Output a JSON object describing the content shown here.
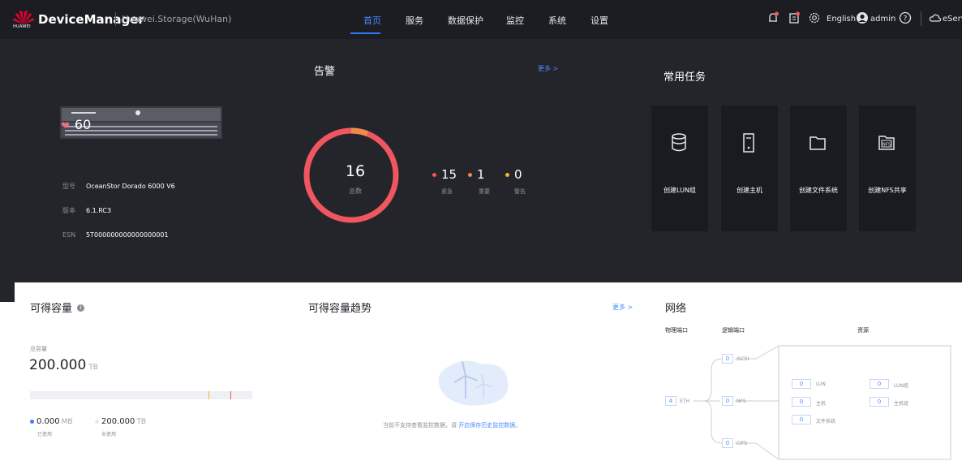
{
  "header": {
    "brand_logo_text": "HUAWEI",
    "app_title": "DeviceManager",
    "device_name": "Huawei.Storage(WuHan)",
    "nav": [
      "首页",
      "服务",
      "数据保护",
      "监控",
      "系统",
      "设置"
    ],
    "active_nav": "首页",
    "language": "English",
    "user": "admin",
    "eservice": "eServ"
  },
  "device": {
    "health_score": "60",
    "model_key": "型号",
    "model_val": "OceanStor Dorado 6000 V6",
    "version_key": "版本",
    "version_val": "6.1.RC3",
    "esn_key": "ESN",
    "esn_val": "5T000000000000000001"
  },
  "alarms": {
    "title": "告警",
    "more": "更多 >",
    "total": "16",
    "total_label": "总数",
    "critical": "15",
    "critical_label": "紧急",
    "major": "1",
    "major_label": "重要",
    "warning": "0",
    "warning_label": "警告",
    "colors": {
      "critical": "#f0565f",
      "major": "#f08a4b",
      "warning": "#f5b630"
    }
  },
  "tasks": {
    "title": "常用任务",
    "items": [
      {
        "label": "创建LUN组",
        "icon": "database-icon"
      },
      {
        "label": "创建主机",
        "icon": "server-icon"
      },
      {
        "label": "创建文件系统",
        "icon": "folder-icon"
      },
      {
        "label": "创建NFS共享",
        "icon": "nfs-share-icon",
        "badge": "NFS"
      }
    ]
  },
  "capacity": {
    "title": "可得容量",
    "total_label": "总容量",
    "total_value": "200.000",
    "total_unit": "TB",
    "used_value": "0.000",
    "used_unit": "MB",
    "used_label": "已使用",
    "free_value": "200.000",
    "free_unit": "TB",
    "free_label": "未使用",
    "used_fraction": 0,
    "colors": {
      "used": "#3b7bff",
      "threshold_1": "#f5b630",
      "threshold_2": "#f0565f"
    }
  },
  "trend": {
    "title": "可得容量趋势",
    "more": "更多 >",
    "empty_msg": "当前不支持查看监控数据，请",
    "empty_link": "开启保存历史监控数据",
    "empty_end": "。"
  },
  "network": {
    "title": "网络",
    "col_physical": "物理端口",
    "col_logical": "逻辑端口",
    "col_resource": "资源",
    "eth_count": "4",
    "eth_label": "ETH",
    "iscsi_count": "0",
    "iscsi_label": "iSCSI",
    "nfs_count": "0",
    "nfs_label": "NFS",
    "cifs_count": "0",
    "cifs_label": "CIFS",
    "resources": [
      {
        "count": "0",
        "label": "LUN"
      },
      {
        "count": "0",
        "label": "LUN组"
      },
      {
        "count": "0",
        "label": "主机"
      },
      {
        "count": "0",
        "label": "主机组"
      },
      {
        "count": "0",
        "label": "文件系统"
      }
    ]
  }
}
